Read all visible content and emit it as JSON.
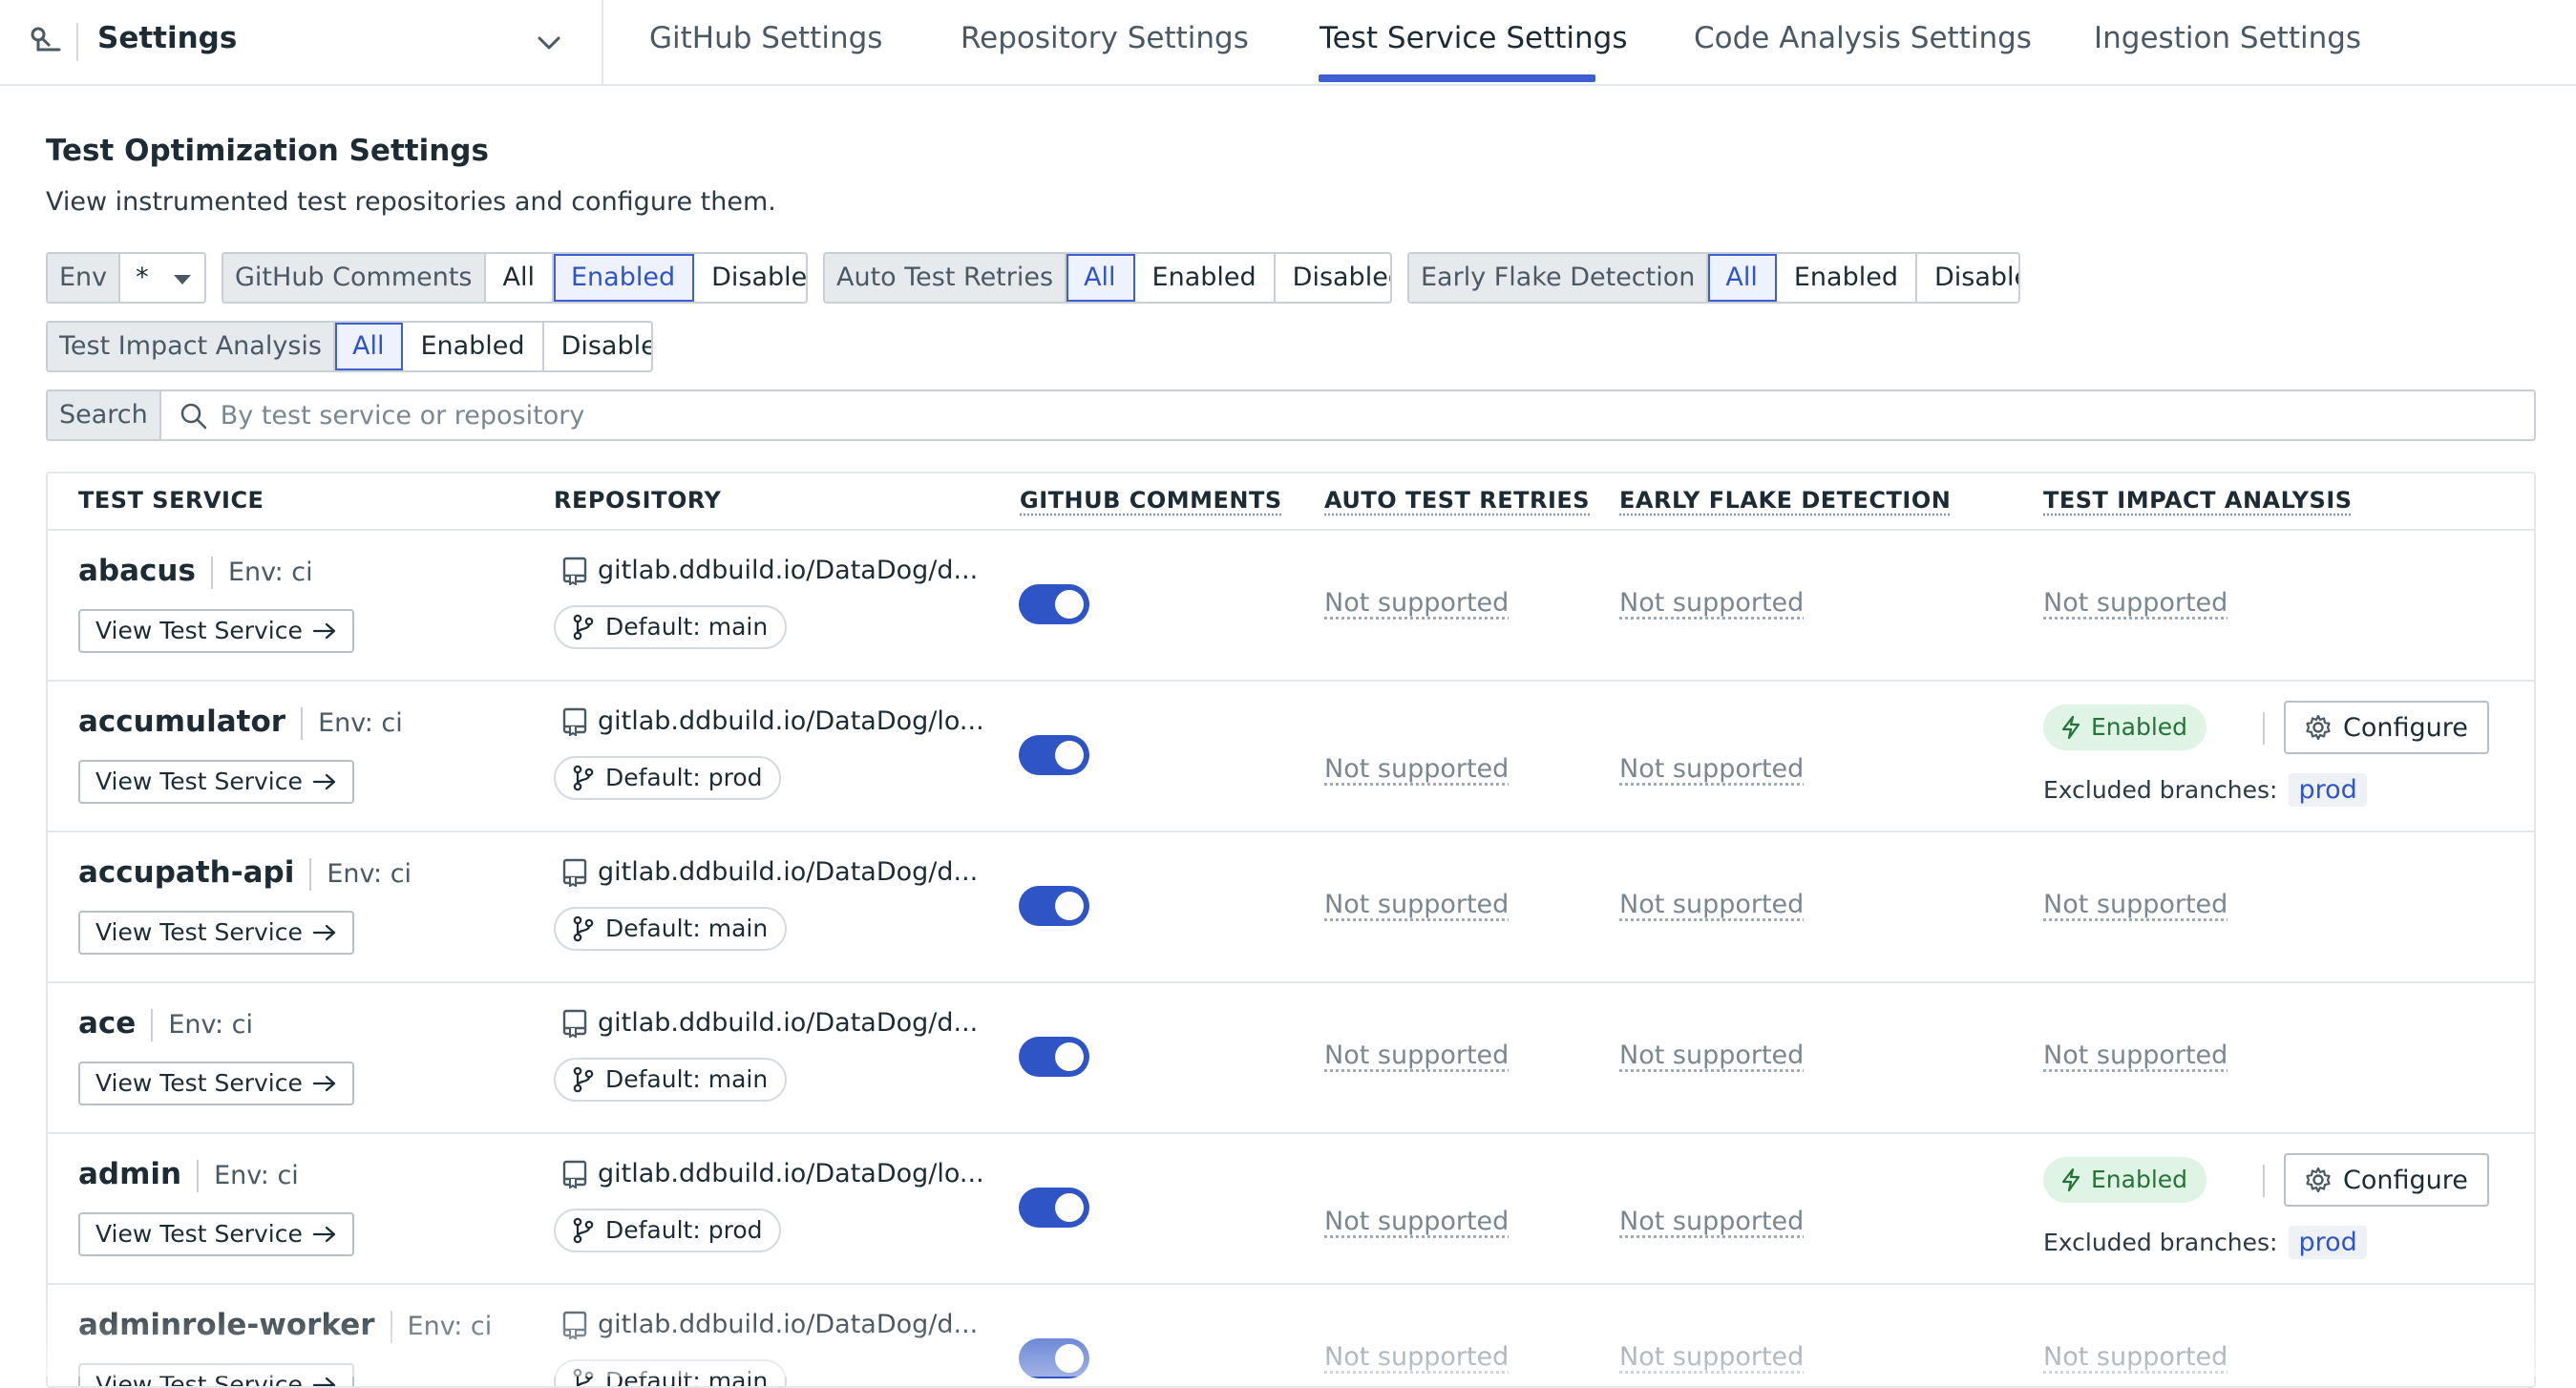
{
  "app": {
    "title": "Settings",
    "icon": "integrations-icon"
  },
  "tabs": [
    {
      "label": "GitHub Settings",
      "active": false
    },
    {
      "label": "Repository Settings",
      "active": false
    },
    {
      "label": "Test Service Settings",
      "active": true
    },
    {
      "label": "Code Analysis Settings",
      "active": false
    },
    {
      "label": "Ingestion Settings",
      "active": false
    }
  ],
  "page": {
    "title": "Test Optimization Settings",
    "subtitle": "View instrumented test repositories and configure them."
  },
  "filters": {
    "env": {
      "label": "Env",
      "value": "*"
    },
    "github_comments": {
      "label": "GitHub Comments",
      "options": [
        "All",
        "Enabled",
        "Disabled"
      ],
      "selected": "Enabled"
    },
    "auto_test_retries": {
      "label": "Auto Test Retries",
      "options": [
        "All",
        "Enabled",
        "Disabled"
      ],
      "selected": "All"
    },
    "early_flake_detection": {
      "label": "Early Flake Detection",
      "options": [
        "All",
        "Enabled",
        "Disabled"
      ],
      "selected": "All"
    },
    "test_impact_analysis": {
      "label": "Test Impact Analysis",
      "options": [
        "All",
        "Enabled",
        "Disabled"
      ],
      "selected": "All"
    }
  },
  "search": {
    "label": "Search",
    "placeholder": "By test service or repository",
    "value": ""
  },
  "table": {
    "columns": [
      "TEST SERVICE",
      "REPOSITORY",
      "GITHUB COMMENTS",
      "AUTO TEST RETRIES",
      "EARLY FLAKE DETECTION",
      "TEST IMPACT ANALYSIS"
    ],
    "view_label": "View Test Service",
    "not_supported": "Not supported",
    "enabled_label": "Enabled",
    "configure_label": "Configure",
    "excluded_label": "Excluded branches:",
    "rows": [
      {
        "service": "abacus",
        "env": "Env: ci",
        "repo": "gitlab.ddbuild.io/DataDog/d...",
        "branch": "Default: main",
        "github_comments": true,
        "tia_enabled": false,
        "excluded": ""
      },
      {
        "service": "accumulator",
        "env": "Env: ci",
        "repo": "gitlab.ddbuild.io/DataDog/lo...",
        "branch": "Default: prod",
        "github_comments": true,
        "tia_enabled": true,
        "excluded": "prod"
      },
      {
        "service": "accupath-api",
        "env": "Env: ci",
        "repo": "gitlab.ddbuild.io/DataDog/d...",
        "branch": "Default: main",
        "github_comments": true,
        "tia_enabled": false,
        "excluded": ""
      },
      {
        "service": "ace",
        "env": "Env: ci",
        "repo": "gitlab.ddbuild.io/DataDog/d...",
        "branch": "Default: main",
        "github_comments": true,
        "tia_enabled": false,
        "excluded": ""
      },
      {
        "service": "admin",
        "env": "Env: ci",
        "repo": "gitlab.ddbuild.io/DataDog/lo...",
        "branch": "Default: prod",
        "github_comments": true,
        "tia_enabled": true,
        "excluded": "prod"
      },
      {
        "service": "adminrole-worker",
        "env": "Env: ci",
        "repo": "gitlab.ddbuild.io/DataDog/d...",
        "branch": "Default: main",
        "github_comments": true,
        "tia_enabled": false,
        "excluded": ""
      }
    ]
  },
  "colors": {
    "accent": "#3d5fd1",
    "toggle_on": "#2e54c6",
    "enabled_bg": "#dff4e4",
    "enabled_text": "#25723a"
  }
}
